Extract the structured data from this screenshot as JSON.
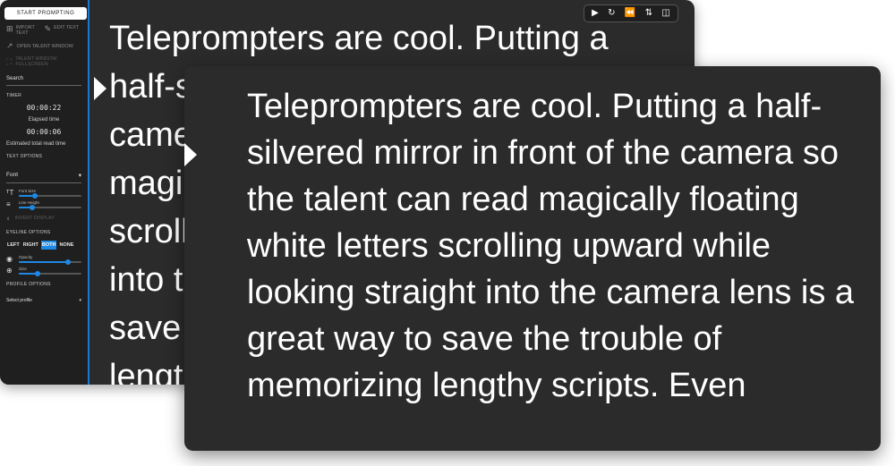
{
  "sidebar": {
    "start_label": "START PROMPTING",
    "import_label": "IMPORT TEXT",
    "edit_label": "EDIT TEXT",
    "open_talent_label": "OPEN TALENT WINDOW",
    "fullscreen_label": "TALENT WINDOW FULLSCREEN",
    "search_label": "Search",
    "timer": {
      "heading": "TIMER",
      "elapsed_value": "00:00:22",
      "elapsed_label": "Elapsed time",
      "estimated_value": "00:00:06",
      "estimated_label": "Estimated total read time"
    },
    "text_options": {
      "heading": "TEXT OPTIONS",
      "font_label": "Font",
      "font_size_label": "Font Size",
      "font_size_value": 0.25,
      "line_height_label": "Line Height",
      "line_height_value": 0.22,
      "invert_label": "INVERT DISPLAY"
    },
    "eyeline": {
      "heading": "EYELINE OPTIONS",
      "buttons": [
        "LEFT",
        "RIGHT",
        "BOTH",
        "NONE"
      ],
      "selected": "BOTH",
      "opacity_label": "Opacity",
      "opacity_value": 0.78,
      "size_label": "Size",
      "size_value": 0.3
    },
    "profile": {
      "heading": "PROFILE OPTIONS",
      "select_label": "Select profile"
    }
  },
  "toolbar": {
    "icons": [
      "play-icon",
      "replay-icon",
      "rewind-icon",
      "flip-icon",
      "split-view-icon"
    ]
  },
  "prompter_text": "Teleprompters are cool. Putting a half-silvered mirror in front of the camera so the talent can read magically floating white letters scrolling upward while looking straight into the camera lens is a great way to save the trouble of memorizing lengthy scripts. Even",
  "colors": {
    "accent": "#1e88e5",
    "window_bg": "#2b2b2b",
    "sidebar_bg": "#1f1f1f",
    "text": "#ffffff"
  }
}
